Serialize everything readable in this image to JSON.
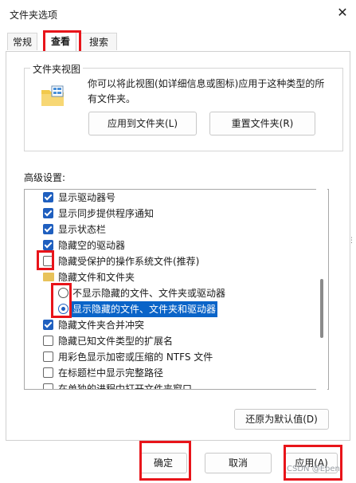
{
  "window": {
    "title": "文件夹选项",
    "close_glyph": "✕"
  },
  "tabs": [
    {
      "label": "常规",
      "active": false
    },
    {
      "label": "查看",
      "active": true
    },
    {
      "label": "搜索",
      "active": false
    }
  ],
  "folder_views": {
    "legend": "文件夹视图",
    "description": "你可以将此视图(如详细信息或图标)应用于这种类型的所有文件夹。",
    "apply_button": "应用到文件夹(L)",
    "reset_button": "重置文件夹(R)"
  },
  "advanced": {
    "label": "高级设置:",
    "items": [
      {
        "type": "checkbox",
        "checked": true,
        "label": "显示驱动器号"
      },
      {
        "type": "checkbox",
        "checked": true,
        "label": "显示同步提供程序通知"
      },
      {
        "type": "checkbox",
        "checked": true,
        "label": "显示状态栏"
      },
      {
        "type": "checkbox",
        "checked": true,
        "label": "隐藏空的驱动器"
      },
      {
        "type": "checkbox",
        "checked": false,
        "label": "隐藏受保护的操作系统文件(推荐)"
      },
      {
        "type": "folder",
        "label": "隐藏文件和文件夹"
      },
      {
        "type": "radio",
        "checked": false,
        "label": "不显示隐藏的文件、文件夹或驱动器"
      },
      {
        "type": "radio",
        "checked": true,
        "label": "显示隐藏的文件、文件夹和驱动器",
        "selected": true
      },
      {
        "type": "checkbox",
        "checked": true,
        "label": "隐藏文件夹合并冲突"
      },
      {
        "type": "checkbox",
        "checked": false,
        "label": "隐藏已知文件类型的扩展名"
      },
      {
        "type": "checkbox",
        "checked": false,
        "label": "用彩色显示加密或压缩的 NTFS 文件"
      },
      {
        "type": "checkbox",
        "checked": false,
        "label": "在标题栏中显示完整路径"
      },
      {
        "type": "checkbox",
        "checked": false,
        "label": "在单独的进程中打开文件夹窗口"
      }
    ],
    "restore_button": "还原为默认值(D)"
  },
  "footer": {
    "ok_button": "确定",
    "cancel_button": "取消",
    "apply_button": "应用(A)"
  },
  "watermark": "CSDN @Epen",
  "colors": {
    "highlight": "#e8141a",
    "accent": "#1f5fbf",
    "selection": "#0a64c8"
  }
}
